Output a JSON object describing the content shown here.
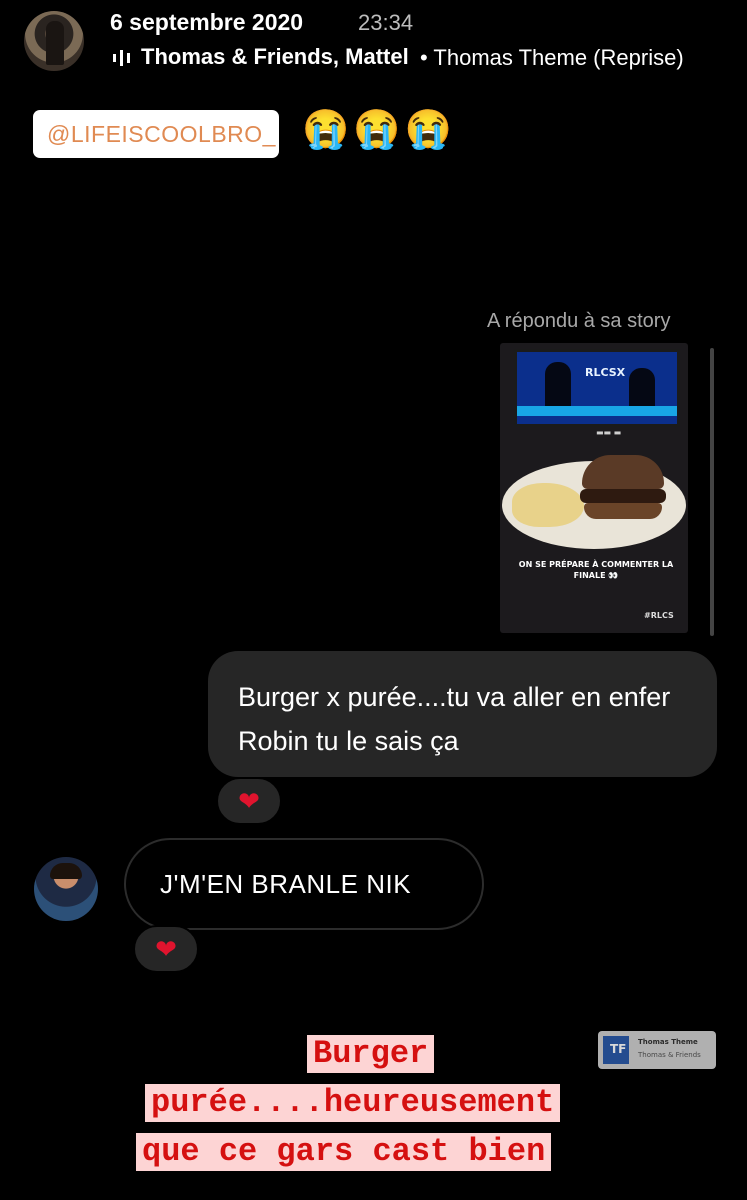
{
  "header": {
    "date": "6 septembre 2020",
    "time": "23:34",
    "music_artist": "Thomas & Friends, Mattel",
    "music_separator_song": "• Thomas Theme (Reprise)"
  },
  "sticker": {
    "mention": "@LIFEISCOOLBRO_",
    "emojis": "😭😭😭"
  },
  "story_reply": {
    "label": "A répondu à sa story",
    "thumb_tv_logo": "RLCSX",
    "thumb_caption": "ON SE PRÉPARE À COMMENTER LA FINALE 👀",
    "thumb_tag": "#RLCS"
  },
  "messages": [
    {
      "direction": "outgoing",
      "text": "Burger x purée....tu va aller en enfer Robin tu le sais ça",
      "reaction": "❤"
    },
    {
      "direction": "incoming",
      "text": "J'M'EN BRANLE NIK",
      "reaction": "❤"
    }
  ],
  "music_widget": {
    "title": "Thomas Theme",
    "artist": "Thomas & Friends"
  },
  "overlay_text": {
    "line1": "Burger",
    "line2": "purée....heureusement",
    "line3": "que ce gars cast bien"
  },
  "colors": {
    "background": "#000000",
    "bubble": "#262626",
    "heart": "#e0142e",
    "overlay_text": "#d51010",
    "overlay_bg": "#fdd4d4"
  }
}
